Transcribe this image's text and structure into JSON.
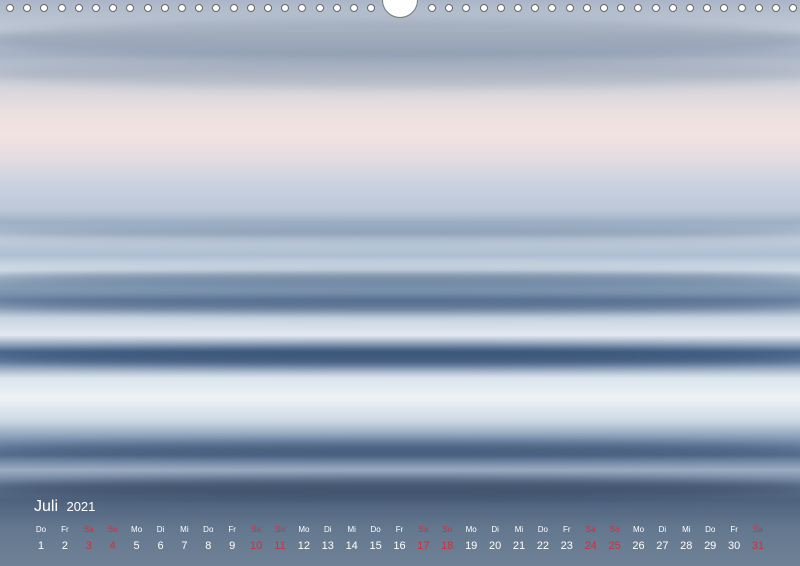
{
  "calendar": {
    "month_name": "Juli",
    "year": "2021",
    "weekend_color": "#d0303a",
    "days": [
      {
        "wd": "Do",
        "d": "1"
      },
      {
        "wd": "Fr",
        "d": "2"
      },
      {
        "wd": "Sa",
        "d": "3"
      },
      {
        "wd": "So",
        "d": "4"
      },
      {
        "wd": "Mo",
        "d": "5"
      },
      {
        "wd": "Di",
        "d": "6"
      },
      {
        "wd": "Mi",
        "d": "7"
      },
      {
        "wd": "Do",
        "d": "8"
      },
      {
        "wd": "Fr",
        "d": "9"
      },
      {
        "wd": "Sa",
        "d": "10"
      },
      {
        "wd": "So",
        "d": "11"
      },
      {
        "wd": "Mo",
        "d": "12"
      },
      {
        "wd": "Di",
        "d": "13"
      },
      {
        "wd": "Mi",
        "d": "14"
      },
      {
        "wd": "Do",
        "d": "15"
      },
      {
        "wd": "Fr",
        "d": "16"
      },
      {
        "wd": "Sa",
        "d": "17"
      },
      {
        "wd": "So",
        "d": "18"
      },
      {
        "wd": "Mo",
        "d": "19"
      },
      {
        "wd": "Di",
        "d": "20"
      },
      {
        "wd": "Mi",
        "d": "21"
      },
      {
        "wd": "Do",
        "d": "22"
      },
      {
        "wd": "Fr",
        "d": "23"
      },
      {
        "wd": "Sa",
        "d": "24"
      },
      {
        "wd": "So",
        "d": "25"
      },
      {
        "wd": "Mo",
        "d": "26"
      },
      {
        "wd": "Di",
        "d": "27"
      },
      {
        "wd": "Mi",
        "d": "28"
      },
      {
        "wd": "Do",
        "d": "29"
      },
      {
        "wd": "Fr",
        "d": "30"
      },
      {
        "wd": "Sa",
        "d": "31"
      }
    ]
  }
}
